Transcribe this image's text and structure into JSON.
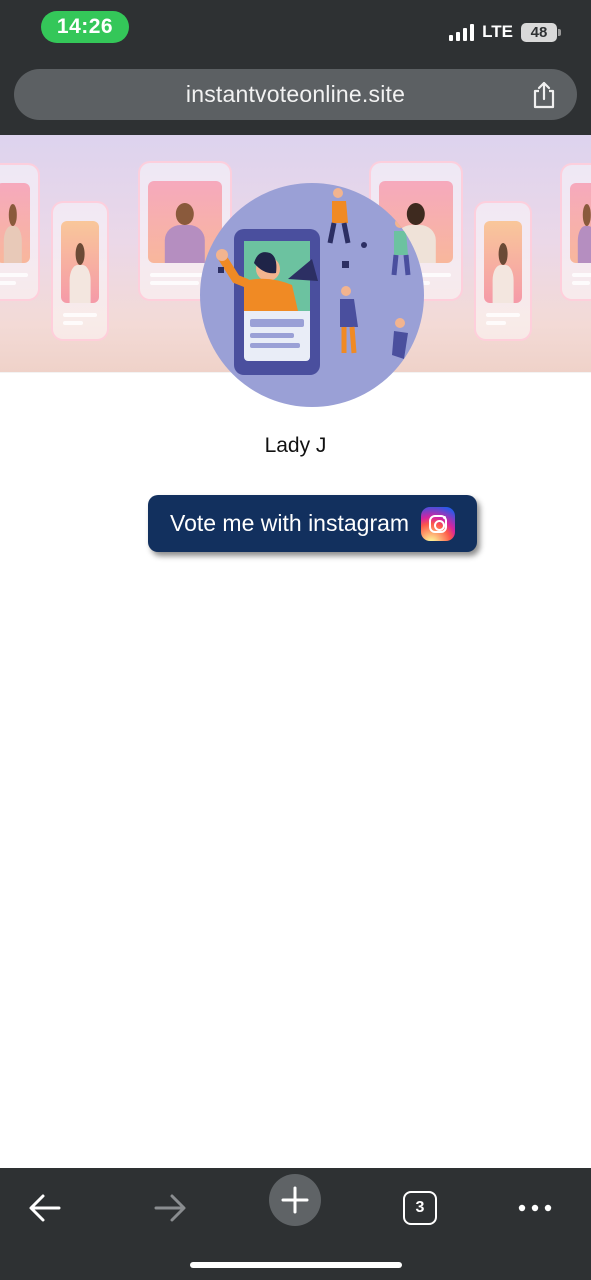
{
  "status_bar": {
    "time": "14:26",
    "network": "LTE",
    "battery": "48"
  },
  "browser": {
    "url": "instantvoteonline.site",
    "open_tabs": "3"
  },
  "profile": {
    "name": "Lady J"
  },
  "vote_button": {
    "label": "Vote me with instagram",
    "icon": "instagram-icon"
  },
  "colors": {
    "chrome_bg": "#2e3133",
    "time_pill": "#34c759",
    "button_bg": "#12305e",
    "avatar_bg": "#9aa0d6"
  }
}
